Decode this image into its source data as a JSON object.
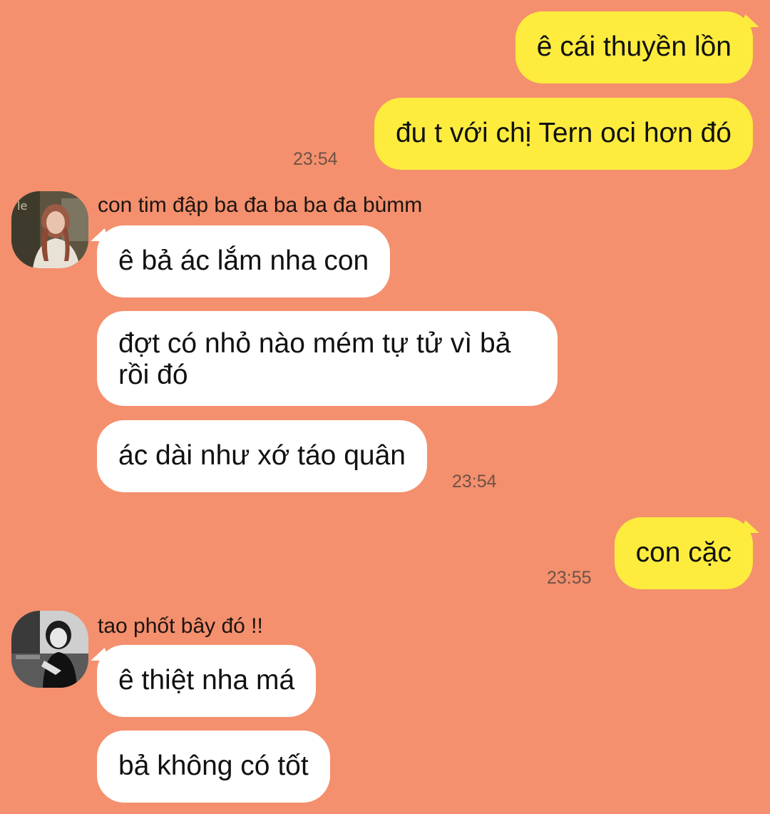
{
  "messages": {
    "m1": {
      "text": "ê cái thuyền lồn"
    },
    "m2": {
      "text": "đu t với chị Tern oci hơn đó",
      "time": "23:54"
    },
    "group1": {
      "sender": "con tim đập ba đa ba ba đa bùmm",
      "m3": "ê bả ác lắm nha con",
      "m4": "đợt có nhỏ nào mém tự tử vì bả rồi đó",
      "m5": "ác dài như xớ táo quân",
      "time": "23:54"
    },
    "m6": {
      "text": "con cặc",
      "time": "23:55"
    },
    "group2": {
      "sender": "tao phốt bây đó !!",
      "m7": "ê thiệt nha má",
      "m8": "bả không có tốt"
    }
  },
  "colors": {
    "background": "#f4906e",
    "outgoing_bubble": "#fdec3e",
    "incoming_bubble": "#ffffff",
    "timestamp": "#6e5246"
  },
  "avatars": {
    "a1": "avatar-girl-photo",
    "a2": "avatar-girl-bw-photo"
  }
}
